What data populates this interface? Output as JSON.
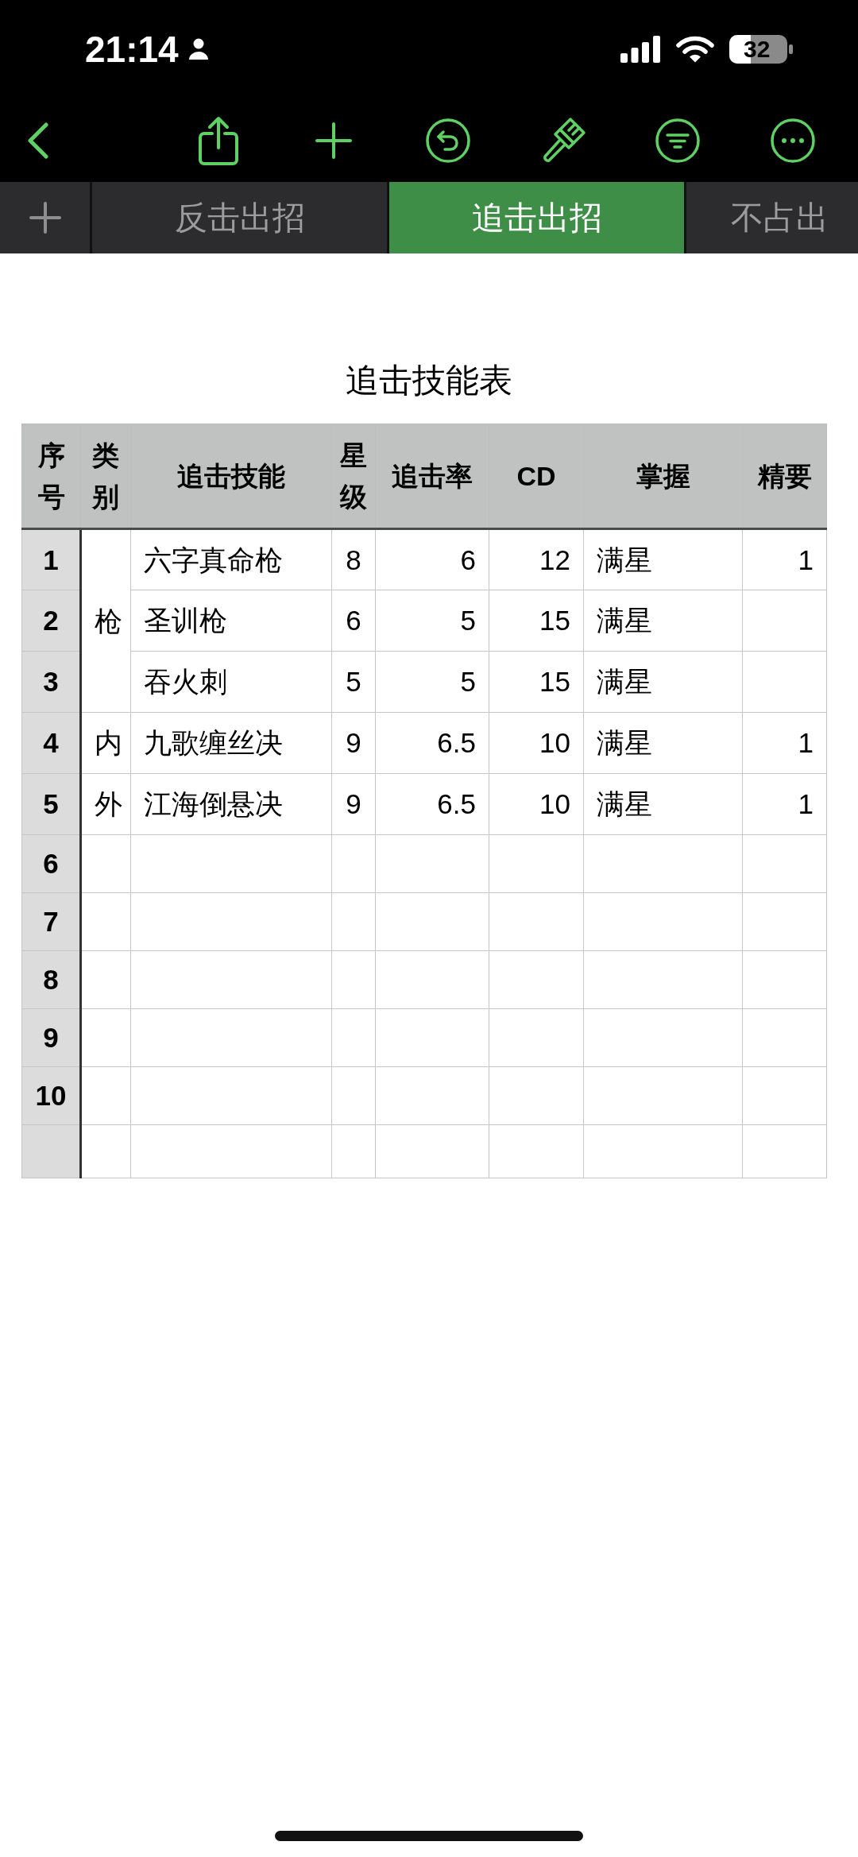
{
  "status_bar": {
    "time": "21:14",
    "battery": "32"
  },
  "sheet_tabs": [
    {
      "label": "反击出招",
      "selected": false
    },
    {
      "label": "追击出招",
      "selected": true
    },
    {
      "label": "不占出",
      "selected": false
    }
  ],
  "table": {
    "title": "追击技能表",
    "columns": [
      "序号",
      "类别",
      "追击技能",
      "星级",
      "追击率",
      "CD",
      "掌握",
      "精要"
    ],
    "groups": [
      {
        "category": "枪",
        "rows": [
          {
            "number": "1",
            "skill": "六字真命枪",
            "star_level": "8",
            "rate": "6",
            "cd": "12",
            "mastery": "满星",
            "essential": "1"
          },
          {
            "number": "2",
            "skill": "圣训枪",
            "star_level": "6",
            "rate": "5",
            "cd": "15",
            "mastery": "满星"
          },
          {
            "number": "3",
            "skill": "吞火刺",
            "star_level": "5",
            "rate": "5",
            "cd": "15",
            "mastery": "满星"
          }
        ]
      },
      {
        "category": "内",
        "rows": [
          {
            "number": "4",
            "skill": "九歌缠丝决",
            "star_level": "9",
            "rate": "6.5",
            "cd": "10",
            "mastery": "满星",
            "essential": "1"
          }
        ]
      },
      {
        "category": "外",
        "rows": [
          {
            "number": "5",
            "skill": "江海倒悬决",
            "star_level": "9",
            "rate": "6.5",
            "cd": "10",
            "mastery": "满星",
            "essential": "1"
          }
        ]
      },
      {
        "rows": [
          {
            "number": "6"
          }
        ]
      },
      {
        "rows": [
          {
            "number": "7"
          }
        ]
      },
      {
        "rows": [
          {
            "number": "8"
          }
        ]
      },
      {
        "rows": [
          {
            "number": "9"
          }
        ]
      },
      {
        "rows": [
          {
            "number": "10"
          }
        ]
      },
      {
        "rows": [
          {}
        ]
      }
    ]
  }
}
